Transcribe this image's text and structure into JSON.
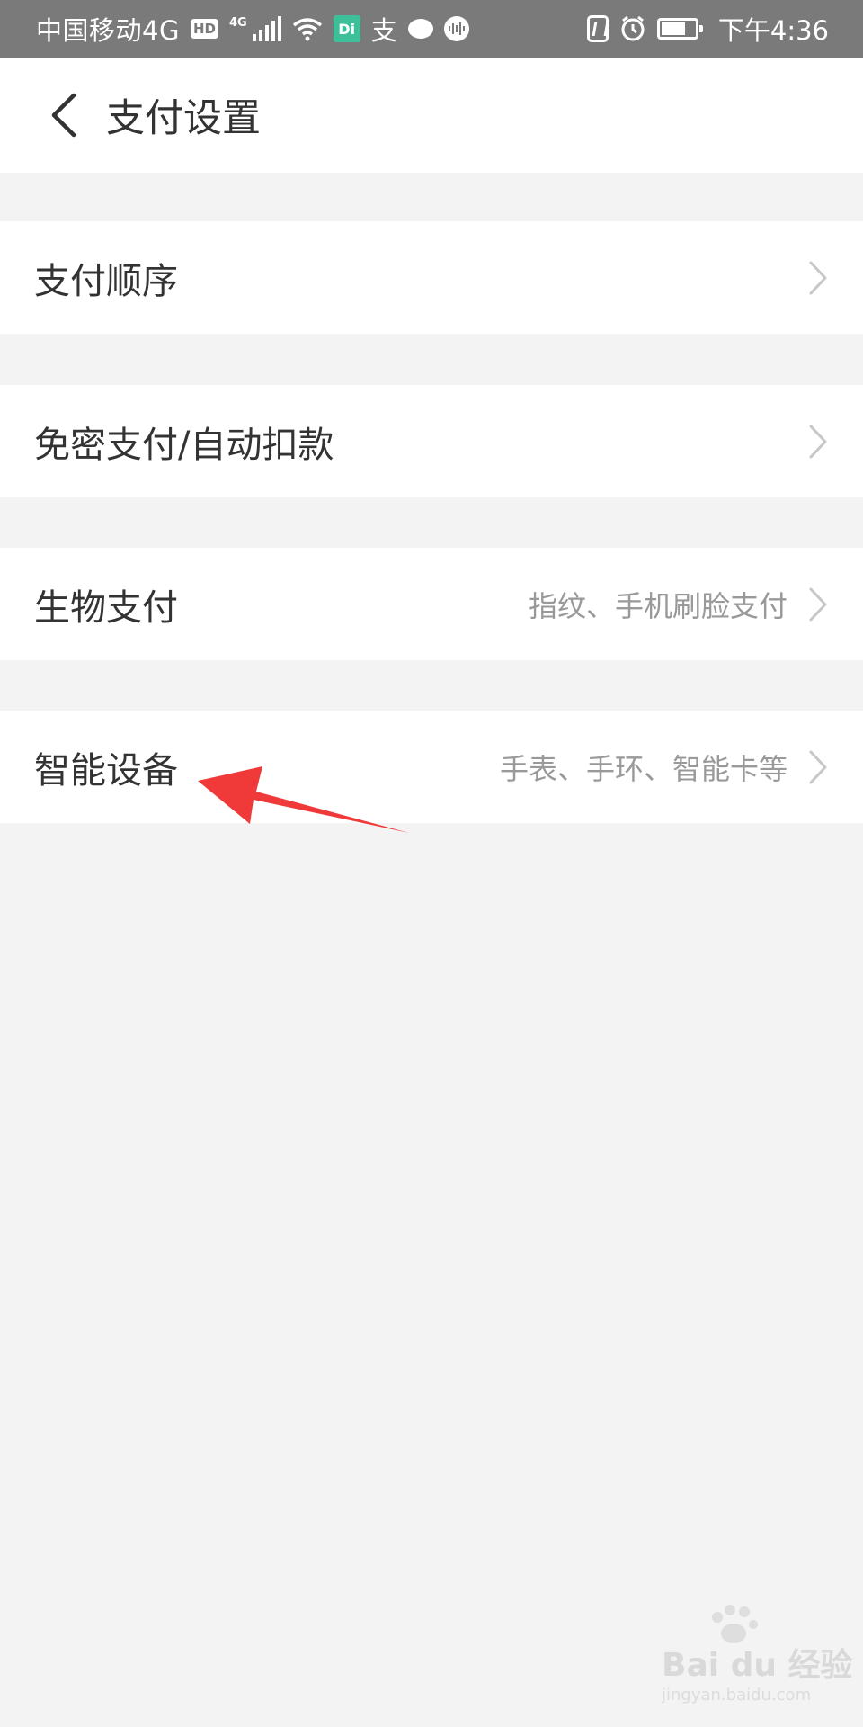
{
  "status_bar": {
    "carrier": "中国移动4G",
    "hd_badge": "HD",
    "network_type": "4G",
    "app_badge": "Di",
    "alipay_glyph": "支",
    "time": "下午4:36",
    "icons": [
      "hd-icon",
      "signal-icon",
      "wifi-icon",
      "app-icon",
      "alipay-icon",
      "chat-icon",
      "audio-icon",
      "nfc-icon",
      "alarm-icon",
      "battery-icon"
    ]
  },
  "header": {
    "title": "支付设置",
    "back_icon": "chevron-left-icon"
  },
  "settings": [
    {
      "label": "支付顺序",
      "value": ""
    },
    {
      "label": "免密支付/自动扣款",
      "value": ""
    },
    {
      "label": "生物支付",
      "value": "指纹、手机刷脸支付"
    },
    {
      "label": "智能设备",
      "value": "手表、手环、智能卡等"
    }
  ],
  "annotation": {
    "arrow_color": "#f03a3a"
  },
  "watermark": {
    "brand": "Bai du 经验",
    "url": "jingyan.baidu.com"
  },
  "colors": {
    "status_bar": "#7a7a7a",
    "background": "#f3f3f3",
    "text_primary": "#333333",
    "text_secondary": "#999999"
  }
}
